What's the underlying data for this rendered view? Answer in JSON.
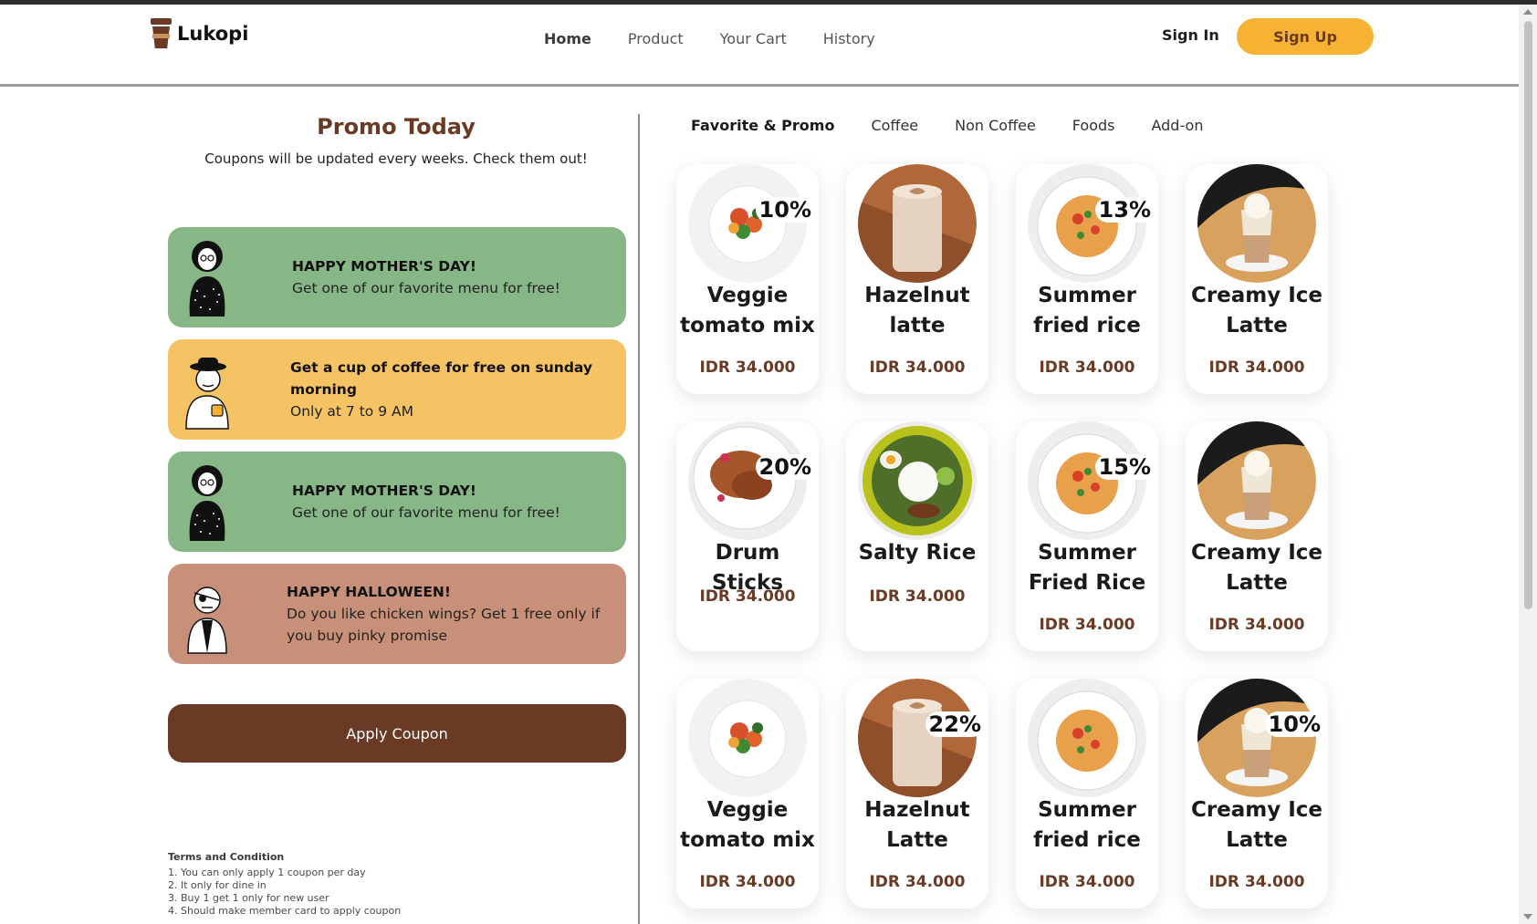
{
  "brand": {
    "name": "Lukopi"
  },
  "nav": {
    "items": [
      {
        "label": "Home",
        "active": true
      },
      {
        "label": "Product",
        "active": false
      },
      {
        "label": "Your Cart",
        "active": false
      },
      {
        "label": "History",
        "active": false
      }
    ],
    "signin": "Sign In",
    "signup": "Sign Up"
  },
  "colors": {
    "brand_brown": "#6b3a24",
    "accent_yellow": "#f6b232",
    "coupon_green": "#87b787",
    "coupon_yellow": "#f5c363",
    "coupon_brown": "#c89078"
  },
  "promo": {
    "title": "Promo Today",
    "subtitle": "Coupons will be updated every weeks. Check them out!",
    "coupons": [
      {
        "title": "HAPPY MOTHER'S DAY!",
        "desc": "Get one of our favorite menu for free!",
        "color": "green",
        "avatar": "woman-hijab-icon"
      },
      {
        "title": "Get a cup of coffee for free on sunday morning",
        "desc": "Only at 7 to 9 AM",
        "color": "yellow",
        "avatar": "man-hat-coffee-icon"
      },
      {
        "title": "HAPPY MOTHER'S DAY!",
        "desc": "Get one of our favorite menu for free!",
        "color": "green",
        "avatar": "woman-hijab-icon"
      },
      {
        "title": "HAPPY HALLOWEEN!",
        "desc": "Do you like chicken wings? Get 1 free only if you buy pinky promise",
        "color": "brown",
        "avatar": "pirate-icon"
      }
    ],
    "apply_label": "Apply Coupon",
    "terms_title": "Terms and Condition",
    "terms": [
      "1. You can only apply 1 coupon per day",
      "2. It only for dine in",
      "3. Buy 1 get 1 only for new user",
      "4. Should make member card to apply coupon"
    ]
  },
  "tabs": [
    {
      "label": "Favorite & Promo",
      "active": true
    },
    {
      "label": "Coffee",
      "active": false
    },
    {
      "label": "Non Coffee",
      "active": false
    },
    {
      "label": "Foods",
      "active": false
    },
    {
      "label": "Add-on",
      "active": false
    }
  ],
  "products": [
    {
      "name": "Veggie tomato mix",
      "price": "IDR 34.000",
      "discount": "10%",
      "image": "veggie-bowl-icon"
    },
    {
      "name": "Hazelnut latte",
      "price": "IDR 34.000",
      "discount": "",
      "image": "latte-icon"
    },
    {
      "name": "Summer fried rice",
      "price": "IDR 34.000",
      "discount": "13%",
      "image": "fried-rice-icon"
    },
    {
      "name": "Creamy Ice Latte",
      "price": "IDR 34.000",
      "discount": "",
      "image": "ice-latte-icon"
    },
    {
      "name": "Drum Sticks",
      "price": "IDR 34.000",
      "discount": "20%",
      "image": "drumsticks-icon"
    },
    {
      "name": "Salty Rice",
      "price": "IDR 34.000",
      "discount": "",
      "image": "salty-rice-icon"
    },
    {
      "name": "Summer Fried Rice",
      "price": "IDR 34.000",
      "discount": "15%",
      "image": "fried-rice-icon"
    },
    {
      "name": "Creamy Ice Latte",
      "price": "IDR 34.000",
      "discount": "",
      "image": "ice-latte-icon"
    },
    {
      "name": "Veggie tomato mix",
      "price": "IDR 34.000",
      "discount": "",
      "image": "veggie-bowl-icon"
    },
    {
      "name": "Hazelnut Latte",
      "price": "IDR 34.000",
      "discount": "22%",
      "image": "latte-icon"
    },
    {
      "name": "Summer fried rice",
      "price": "IDR 34.000",
      "discount": "",
      "image": "fried-rice-icon"
    },
    {
      "name": "Creamy Ice Latte",
      "price": "IDR 34.000",
      "discount": "10%",
      "image": "ice-latte-icon"
    }
  ]
}
